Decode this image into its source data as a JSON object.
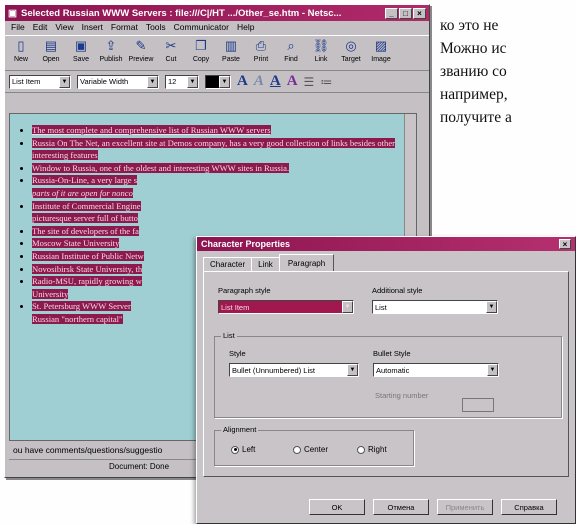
{
  "magazine_lines": [
    "ко это не",
    "Можно ис",
    "званию со",
    "например,",
    "получите а"
  ],
  "window": {
    "title": "Selected Russian WWW Servers : file:///C|/HT .../Other_se.htm - Netsc...",
    "min": "_",
    "max": "□",
    "close": "×"
  },
  "menu": [
    "File",
    "Edit",
    "View",
    "Insert",
    "Format",
    "Tools",
    "Communicator",
    "Help"
  ],
  "toolbar": [
    "New",
    "Open",
    "Save",
    "Publish",
    "Preview",
    "Cut",
    "Copy",
    "Paste",
    "Print",
    "Find",
    "Link",
    "Target",
    "Image"
  ],
  "format": {
    "style": "List Item",
    "font": "Variable Width",
    "size": "12"
  },
  "list_items": [
    "The most complete and comprehensive list of Russian WWW servers",
    "Russia On The Net, an excellent site at Demos company, has a very good collection of links besides other interesting features",
    "Window to Russia, one of the oldest and interesting WWW sites in Russia.",
    "Russia-On-Line, a very large s",
    "Institute of Commercial Engine",
    "The site of developers of the fa",
    "Moscow State University",
    "Russian Institute of Public Netw",
    "Novosibirsk State University, th",
    "Radio-MSU, rapidly growing w",
    "St. Petersburg WWW Server",
    "Russian \"northern capital\""
  ],
  "list_extras": {
    "rol_tail": "parts of it are open for nonco",
    "ice_tail": "picturesque server full of butto",
    "radio_tail": "University",
    "spb_tail": "Russian \"northern capital\""
  },
  "footer_text": "ou have comments/questions/suggestio",
  "status": "Document: Done",
  "dialog": {
    "title": "Character Properties",
    "close": "×",
    "tabs": [
      "Character",
      "Link",
      "Paragraph"
    ],
    "paragraph_style_label": "Paragraph style",
    "paragraph_style_value": "List Item",
    "additional_style_label": "Additional style",
    "additional_style_value": "List",
    "list_group": "List",
    "style_label": "Style",
    "style_value": "Bullet (Unnumbered) List",
    "bullet_style_label": "Bullet Style",
    "bullet_style_value": "Automatic",
    "starting_number_label": "Starting number",
    "alignment_group": "Alignment",
    "align_left": "Left",
    "align_center": "Center",
    "align_right": "Right",
    "buttons": [
      "OK",
      "Отмена",
      "Применить",
      "Справка"
    ]
  }
}
